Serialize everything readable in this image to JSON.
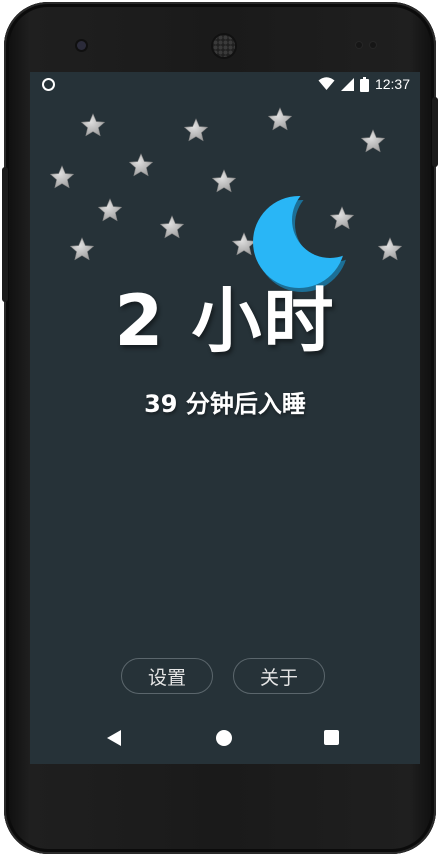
{
  "status_bar": {
    "time": "12:37",
    "icons": [
      "circle-notification-icon",
      "wifi-icon",
      "cell-signal-icon",
      "battery-icon"
    ]
  },
  "main": {
    "hours_text": "2 小时",
    "minutes_text": "39 分钟后入睡"
  },
  "buttons": {
    "settings_label": "设置",
    "about_label": "关于"
  },
  "navigation": {
    "icons": [
      "back-icon",
      "home-icon",
      "recents-icon"
    ]
  },
  "colors": {
    "background": "#263238",
    "moon": "#29B6F6",
    "star": "#BDBDBD"
  }
}
